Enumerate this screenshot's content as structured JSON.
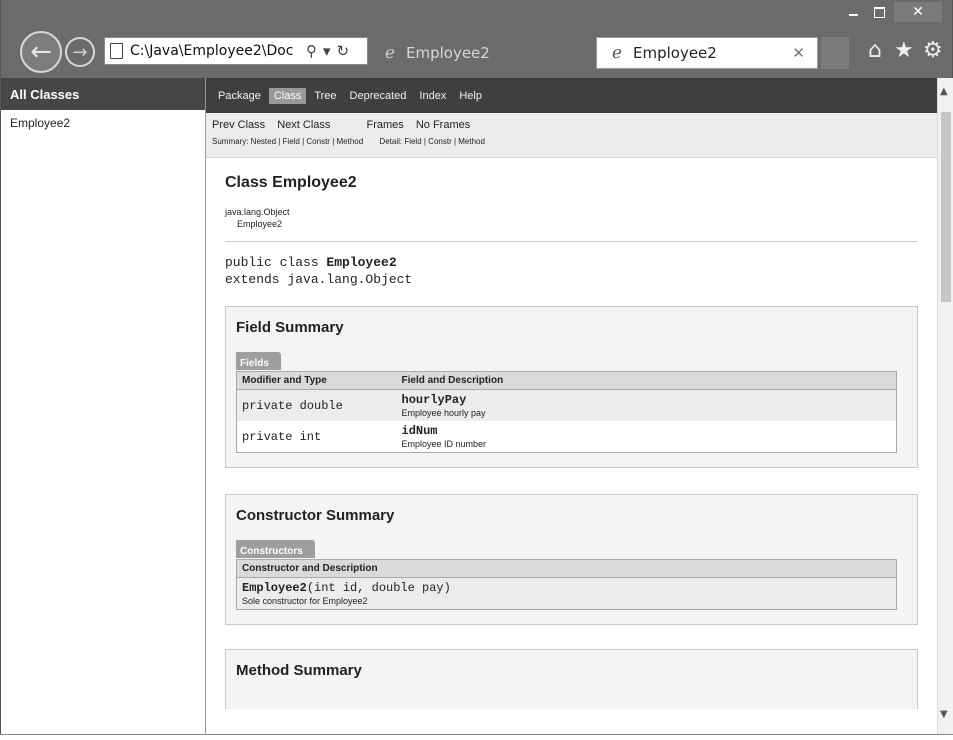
{
  "window": {
    "minimize_glyph": "",
    "maximize_glyph": "",
    "close_glyph": "✕"
  },
  "navbar": {
    "back_glyph": "←",
    "forward_glyph": "→",
    "address": "C:\\Java\\Employee2\\Doc",
    "search_glyph": "⚲",
    "dropdown_glyph": "▾",
    "refresh_glyph": "↻"
  },
  "tabs": [
    {
      "label": "Employee2",
      "icon": "ie-icon"
    },
    {
      "label": "Employee2",
      "icon": "ie-icon",
      "close_glyph": "✕"
    }
  ],
  "tools": {
    "home_glyph": "⌂",
    "favorites_glyph": "★",
    "settings_glyph": "⚙"
  },
  "left_frame": {
    "header": "All Classes",
    "classes": [
      "Employee2"
    ]
  },
  "topnav": {
    "items": [
      "Package",
      "Class",
      "Tree",
      "Deprecated",
      "Index",
      "Help"
    ],
    "active": "Class"
  },
  "subnav": {
    "prev_class": "Prev Class",
    "next_class": "Next Class",
    "frames": "Frames",
    "no_frames": "No Frames",
    "summary_line": "Summary: Nested | Field | Constr | Method",
    "detail_line": "Detail: Field | Constr | Method"
  },
  "content": {
    "class_title": "Class Employee2",
    "inherit_root": "java.lang.Object",
    "inherit_child": "Employee2",
    "decl_prefix": "public class ",
    "decl_name": "Employee2",
    "decl_extends": "extends java.lang.Object"
  },
  "field_summary": {
    "title": "Field Summary",
    "caption": "Fields",
    "headers": [
      "Modifier and Type",
      "Field and Description"
    ],
    "rows": [
      {
        "type": "private double",
        "name": "hourlyPay",
        "desc": "Employee hourly pay"
      },
      {
        "type": "private int",
        "name": "idNum",
        "desc": "Employee ID number"
      }
    ]
  },
  "constructor_summary": {
    "title": "Constructor Summary",
    "caption": "Constructors",
    "header": "Constructor and Description",
    "rows": [
      {
        "signature_name": "Employee2",
        "signature_rest": "(int id, double pay)",
        "desc": "Sole constructor for Employee2"
      }
    ]
  },
  "method_summary": {
    "title": "Method Summary"
  },
  "scrollbar": {
    "up_glyph": "▲",
    "down_glyph": "▼"
  },
  "colors": {
    "chrome": "#6b6b6b",
    "topnav": "#3f3f3f",
    "active_nav": "#9a9a9a",
    "caption_tab": "#9e9e9e"
  }
}
